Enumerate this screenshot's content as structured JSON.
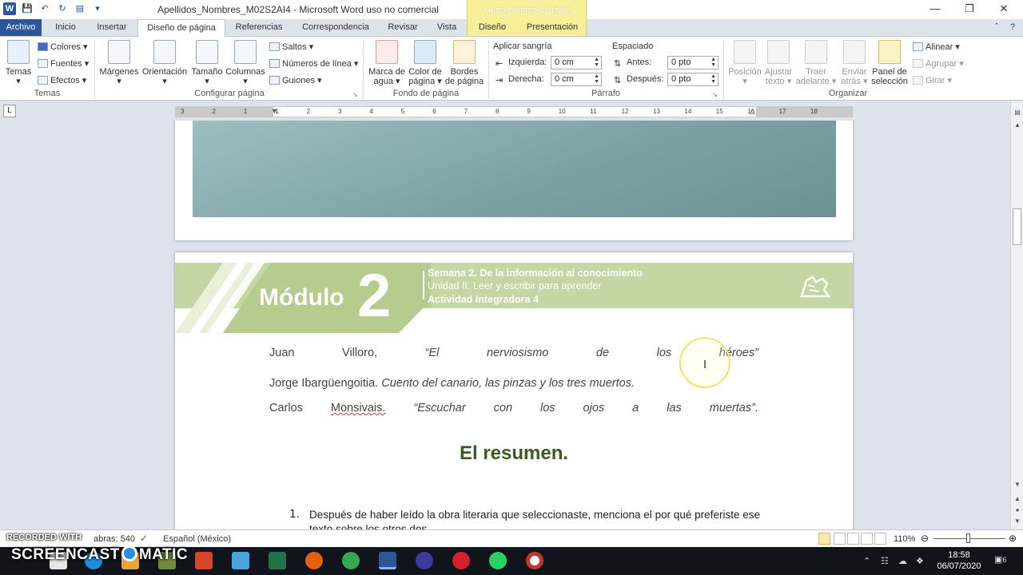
{
  "window": {
    "title": "Apellidos_Nombres_M02S2AI4  -  Microsoft Word uso no comercial",
    "contextual_tab_group": "Herramientas de tabla"
  },
  "tabs": [
    {
      "label": "Archivo"
    },
    {
      "label": "Inicio"
    },
    {
      "label": "Insertar"
    },
    {
      "label": "Diseño de página"
    },
    {
      "label": "Referencias"
    },
    {
      "label": "Correspondencia"
    },
    {
      "label": "Revisar"
    },
    {
      "label": "Vista"
    },
    {
      "label": "Diseño"
    },
    {
      "label": "Presentación"
    }
  ],
  "active_tab": "Diseño de página",
  "ribbon": {
    "temas": {
      "big": "Temas",
      "colores": "Colores",
      "fuentes": "Fuentes",
      "efectos": "Efectos",
      "group": "Temas"
    },
    "configurar": {
      "margenes": "Márgenes",
      "orientacion": "Orientación",
      "tamano": "Tamaño",
      "columnas": "Columnas",
      "saltos": "Saltos",
      "numeros_linea": "Números de línea",
      "guiones": "Guiones",
      "group": "Configurar página"
    },
    "fondo": {
      "marca_1": "Marca de",
      "marca_2": "agua",
      "color_1": "Color de",
      "color_2": "página",
      "bordes_1": "Bordes",
      "bordes_2": "de página",
      "group": "Fondo de página"
    },
    "parrafo": {
      "sangria_label": "Aplicar sangría",
      "izquierda_label": "Izquierda:",
      "izquierda_value": "0 cm",
      "derecha_label": "Derecha:",
      "derecha_value": "0 cm",
      "espaciado_label": "Espaciado",
      "antes_label": "Antes:",
      "antes_value": "0 pto",
      "despues_label": "Después:",
      "despues_value": "0 pto",
      "group": "Párrafo"
    },
    "organizar": {
      "posicion": "Posición",
      "ajustar_1": "Ajustar",
      "ajustar_2": "texto",
      "traer_1": "Traer",
      "traer_2": "adelante",
      "enviar_1": "Enviar",
      "enviar_2": "atrás",
      "panel_1": "Panel de",
      "panel_2": "selección",
      "alinear": "Alinear",
      "agrupar": "Agrupar",
      "girar": "Girar",
      "group": "Organizar"
    }
  },
  "ruler_numbers": [
    "3",
    "2",
    "1",
    "1",
    "2",
    "3",
    "4",
    "5",
    "6",
    "7",
    "8",
    "9",
    "10",
    "11",
    "12",
    "13",
    "14",
    "15",
    "16",
    "17",
    "18"
  ],
  "document": {
    "banner": {
      "modulo_word": "Módulo",
      "modulo_num": "2",
      "semana": "Semana 2. De la información al conocimiento",
      "unidad": "Unidad II. Leer y escribir para aprender",
      "actividad": "Actividad Integradora 4"
    },
    "bib1": {
      "w1": "Juan",
      "w2": "Villoro,",
      "w3": "“El",
      "w4": "nerviosismo",
      "w5": "de",
      "w6": "los",
      "w7": "héroes”"
    },
    "bib2": {
      "author": "Jorge Ibargüengoitia.",
      "work": "Cuento del canario, las pinzas y los tres muertos."
    },
    "bib3": {
      "w1": "Carlos",
      "w2": "Monsivais.",
      "w3": "“Escuchar",
      "w4": "con",
      "w5": "los",
      "w6": "ojos",
      "w7": "a",
      "w8": "las",
      "w9": "muertas”."
    },
    "heading": "El resumen.",
    "question_number": "1.",
    "question_text": "Después de haber leído la obra literaria que seleccionaste, menciona el por qué preferiste ese texto sobre los otros dos."
  },
  "status": {
    "words": "abras: 540",
    "language": "Español (México)",
    "zoom": "110%",
    "zoom_fraction": 0.49
  },
  "taskbar": {
    "time": "18:58",
    "date": "06/07/2020",
    "notifications": "6"
  },
  "watermark": {
    "small": "RECORDED WITH",
    "big_left": "SCREENCAST",
    "big_right": "MATIC"
  },
  "colors": {
    "word_blue": "#2b579a",
    "banner_green": "#c4d6a4",
    "heading_green": "#3d5a22",
    "contextual_yellow": "#f7ee9a"
  }
}
